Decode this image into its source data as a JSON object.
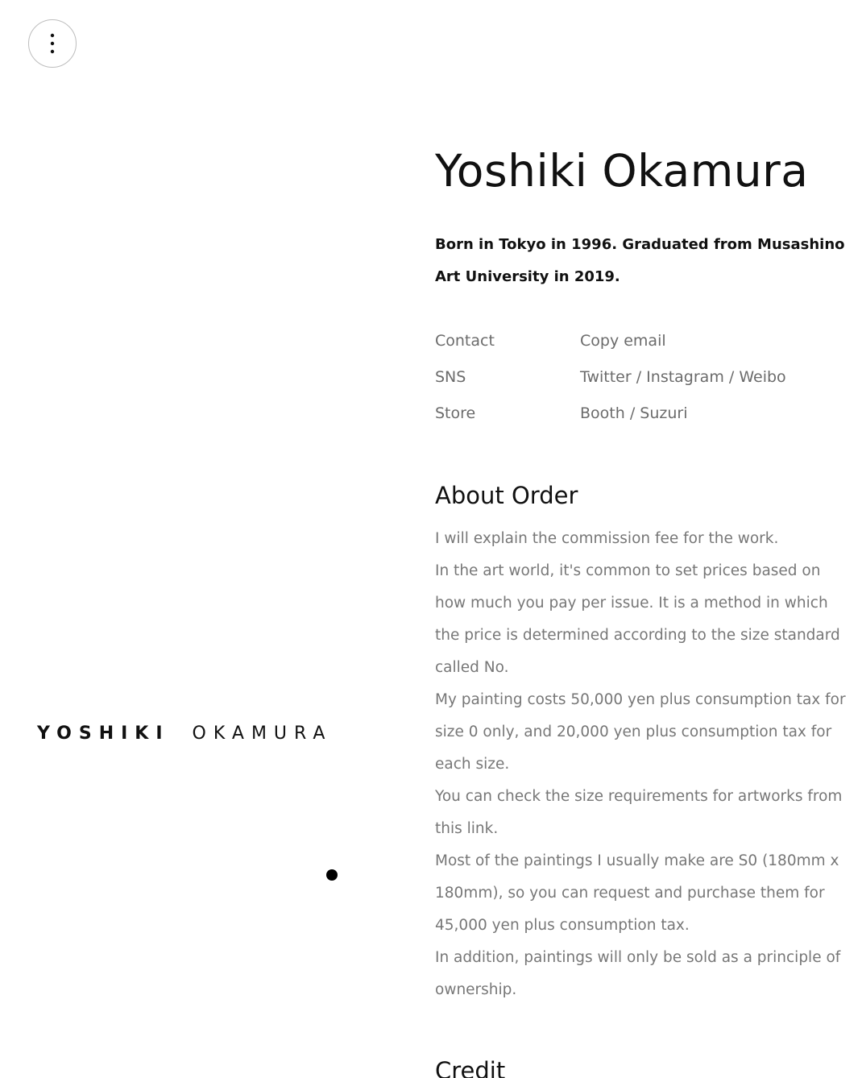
{
  "menu": {
    "icon": "vertical-dots-icon"
  },
  "logo": {
    "first": "YOSHIKI",
    "last": "OKAMURA"
  },
  "profile": {
    "name": "Yoshiki Okamura",
    "bio": "Born in Tokyo in 1996. Graduated from Musashino Art University in 2019."
  },
  "info": {
    "contact_label": "Contact",
    "contact_copy": "Copy email",
    "sns_label": "SNS",
    "sns_links": [
      "Twitter",
      "Instagram",
      "Weibo"
    ],
    "store_label": "Store",
    "store_links": [
      "Booth",
      "Suzuri"
    ],
    "separator": " / "
  },
  "about_order": {
    "title": "About Order",
    "paragraphs": [
      "I will explain the commission fee for the work.",
      "In the art world, it's common to set prices based on how much you pay per issue. It is a method in which the price is determined according to the size standard called No.",
      "My painting costs 50,000 yen plus consumption tax for size 0 only, and 20,000 yen plus consumption tax for each size.",
      "You can check the size requirements for artworks from this link.",
      "Most of the paintings I usually make are S0 (180mm x 180mm), so you can request and purchase them for 45,000 yen plus consumption tax.",
      "In addition, paintings will only be sold as a principle of ownership."
    ]
  },
  "credit": {
    "title": "Credit"
  }
}
